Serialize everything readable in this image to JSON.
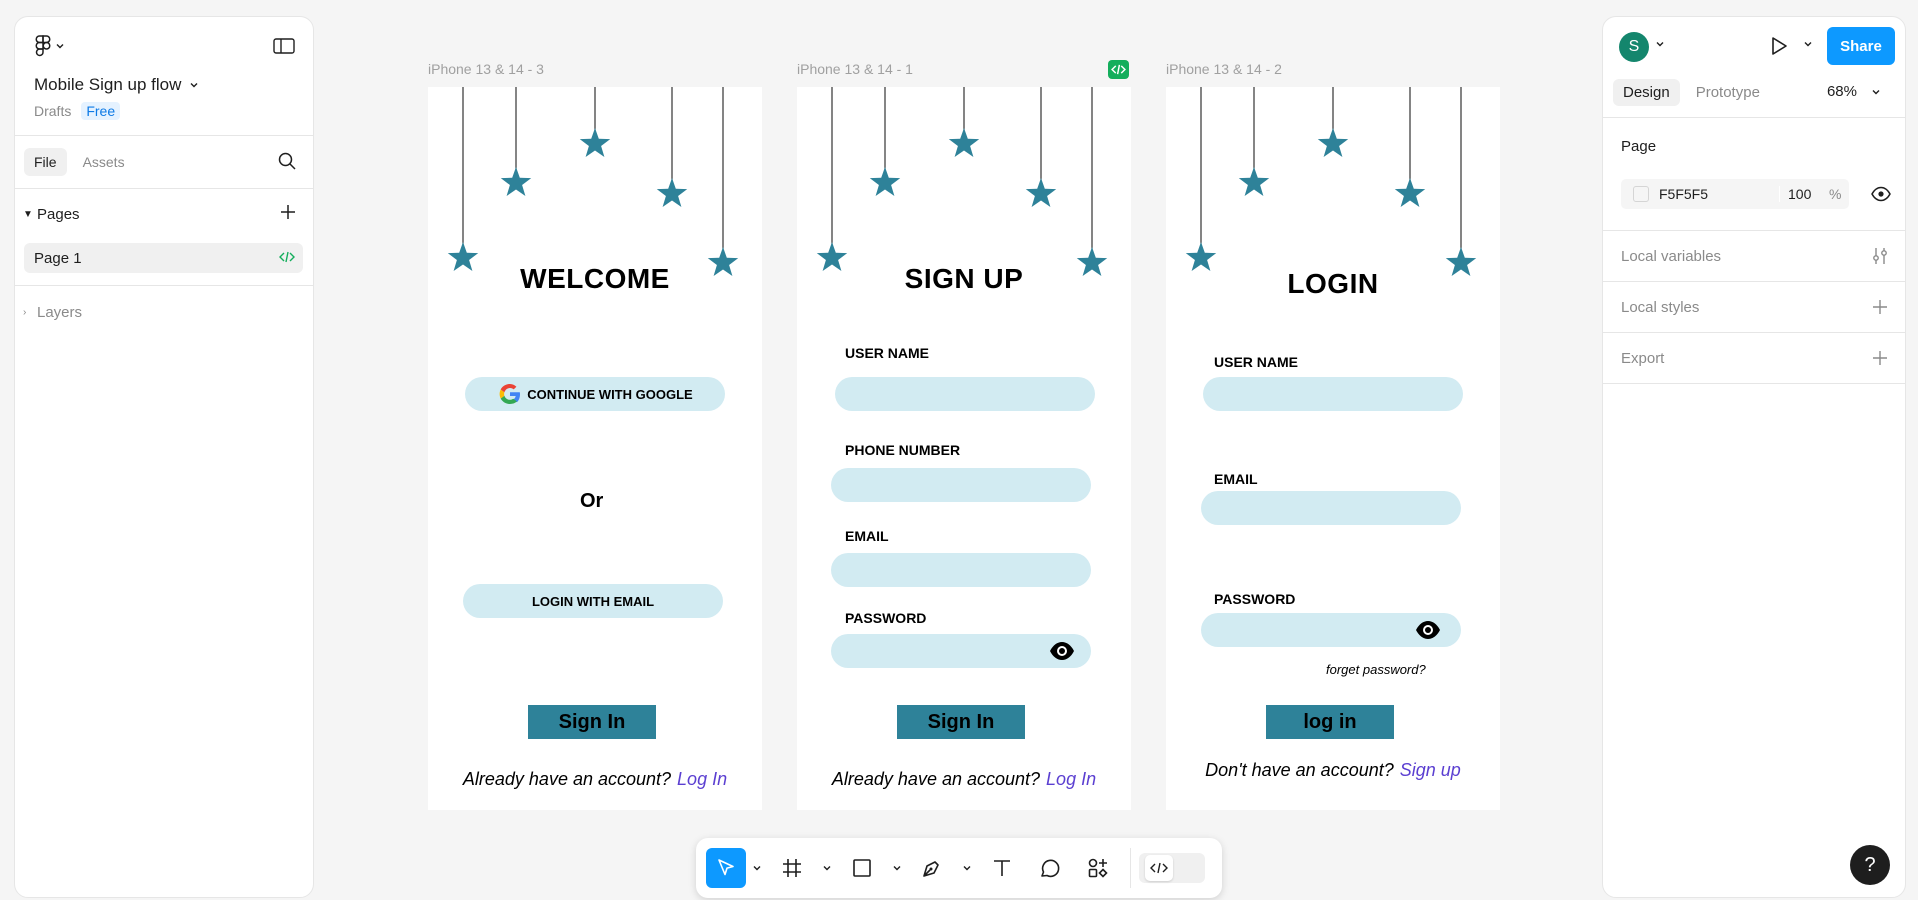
{
  "file": {
    "name": "Mobile Sign up flow",
    "location": "Drafts",
    "plan": "Free"
  },
  "left_panel": {
    "tabs": [
      "File",
      "Assets"
    ],
    "pages_label": "Pages",
    "pages": [
      "Page 1"
    ],
    "layers_label": "Layers"
  },
  "frames": [
    {
      "label": "iPhone 13 & 14 - 3",
      "title": "WELCOME",
      "google_button": "CONTINUE WITH GOOGLE",
      "or_text": "Or",
      "email_button": "LOGIN WITH EMAIL",
      "primary_button": "Sign In",
      "footer_text": "Already have an account?",
      "footer_link": "Log In"
    },
    {
      "label": "iPhone 13 & 14 - 1",
      "title": "SIGN UP",
      "fields": [
        "USER NAME",
        "PHONE NUMBER",
        "EMAIL",
        "PASSWORD"
      ],
      "primary_button": "Sign In",
      "footer_text": "Already have an account?",
      "footer_link": "Log In"
    },
    {
      "label": "iPhone 13 & 14 - 2",
      "title": "LOGIN",
      "fields": [
        "USER NAME",
        "EMAIL",
        "PASSWORD"
      ],
      "forgot_text": "forget password?",
      "primary_button": "log in",
      "footer_text": "Don't have an account?",
      "footer_link": "Sign up"
    }
  ],
  "right_panel": {
    "avatar_initial": "S",
    "share_label": "Share",
    "tabs": [
      "Design",
      "Prototype"
    ],
    "zoom": "68%",
    "page_section": "Page",
    "page_color": "F5F5F5",
    "page_opacity": "100",
    "percent_sign": "%",
    "rows": [
      "Local variables",
      "Local styles",
      "Export"
    ]
  },
  "help_label": "?",
  "colors": {
    "accent": "#0d99ff",
    "star": "#2e8299",
    "input_fill": "#d2ebf2",
    "button_fill": "#2e8299",
    "link": "#5b3fd1",
    "avatar": "#14866d"
  }
}
